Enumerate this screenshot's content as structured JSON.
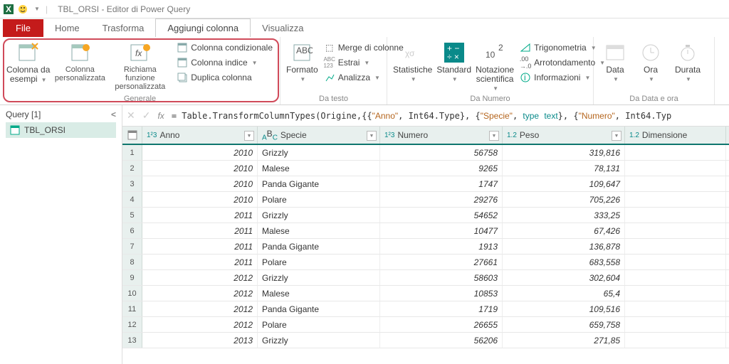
{
  "title": "TBL_ORSI - Editor di Power Query",
  "tabs": {
    "file": "File",
    "home": "Home",
    "trasforma": "Trasforma",
    "aggiungi": "Aggiungi colonna",
    "visualizza": "Visualizza"
  },
  "ribbon": {
    "generale": {
      "label": "Generale",
      "b1": "Colonna da\nesempi",
      "b2": "Colonna\npersonalizzata",
      "b3": "Richiama funzione\npersonalizzata",
      "s1": "Colonna condizionale",
      "s2": "Colonna indice",
      "s3": "Duplica colonna"
    },
    "testo": {
      "label": "Da testo",
      "b1": "Formato",
      "s1": "Merge di colonne",
      "s2": "Estrai",
      "s3": "Analizza"
    },
    "numero": {
      "label": "Da Numero",
      "b1": "Statistiche",
      "b2": "Standard",
      "b3": "Notazione\nscientifica",
      "s1": "Trigonometria",
      "s2": "Arrotondamento",
      "s3": "Informazioni"
    },
    "data": {
      "label": "Da Data e ora",
      "b1": "Data",
      "b2": "Ora",
      "b3": "Durata"
    }
  },
  "queries": {
    "header": "Query [1]",
    "item": "TBL_ORSI"
  },
  "formula": "= Table.TransformColumnTypes(Origine,{{\"Anno\", Int64.Type}, {\"Specie\", type text}, {\"Numero\", Int64.Typ",
  "cols": {
    "c1": "Anno",
    "c2": "Specie",
    "c3": "Numero",
    "c4": "Peso",
    "c5": "Dimensione"
  },
  "rows": [
    {
      "n": "1",
      "anno": "2010",
      "sp": "Grizzly",
      "num": "56758",
      "peso": "319,816"
    },
    {
      "n": "2",
      "anno": "2010",
      "sp": "Malese",
      "num": "9265",
      "peso": "78,131"
    },
    {
      "n": "3",
      "anno": "2010",
      "sp": "Panda Gigante",
      "num": "1747",
      "peso": "109,647"
    },
    {
      "n": "4",
      "anno": "2010",
      "sp": "Polare",
      "num": "29276",
      "peso": "705,226"
    },
    {
      "n": "5",
      "anno": "2011",
      "sp": "Grizzly",
      "num": "54652",
      "peso": "333,25"
    },
    {
      "n": "6",
      "anno": "2011",
      "sp": "Malese",
      "num": "10477",
      "peso": "67,426"
    },
    {
      "n": "7",
      "anno": "2011",
      "sp": "Panda Gigante",
      "num": "1913",
      "peso": "136,878"
    },
    {
      "n": "8",
      "anno": "2011",
      "sp": "Polare",
      "num": "27661",
      "peso": "683,558"
    },
    {
      "n": "9",
      "anno": "2012",
      "sp": "Grizzly",
      "num": "58603",
      "peso": "302,604"
    },
    {
      "n": "10",
      "anno": "2012",
      "sp": "Malese",
      "num": "10853",
      "peso": "65,4"
    },
    {
      "n": "11",
      "anno": "2012",
      "sp": "Panda Gigante",
      "num": "1719",
      "peso": "109,516"
    },
    {
      "n": "12",
      "anno": "2012",
      "sp": "Polare",
      "num": "26655",
      "peso": "659,758"
    },
    {
      "n": "13",
      "anno": "2013",
      "sp": "Grizzly",
      "num": "56206",
      "peso": "271,85"
    }
  ]
}
